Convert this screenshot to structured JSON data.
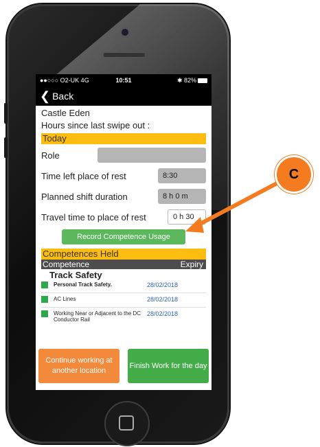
{
  "status_bar": {
    "carrier": "●●○○○ O2-UK  4G",
    "time": "10:51",
    "battery": "✱ 82%"
  },
  "nav": {
    "back_label": "Back"
  },
  "location": {
    "name": "Castle Eden",
    "hours_since_label": "Hours since last swipe out :"
  },
  "today": {
    "header": "Today",
    "role_label": "Role",
    "role_value": "",
    "time_left_label": "Time left place of rest",
    "time_left_value": "8:30",
    "planned_label": "Planned shift duration",
    "planned_value": "8 h  0 m",
    "travel_label": "Travel time to place of rest",
    "travel_value": "0 h 30"
  },
  "record_button": "Record Competence Usage",
  "competences": {
    "header": "Competences Held",
    "col_competence": "Competence",
    "col_expiry": "Expiry",
    "group": "Track Safety",
    "items": [
      {
        "name": "Personal Track Safety.",
        "expiry": "28/02/2018",
        "color": "#2ea84a"
      },
      {
        "name": "AC Lines",
        "expiry": "28/02/2018",
        "color": "#2ea84a"
      },
      {
        "name": "Working Near or Adjacent to the DC Conductor Rail",
        "expiry": "28/02/2018",
        "color": "#2ea84a"
      }
    ]
  },
  "buttons": {
    "continue": "Continue working at another location",
    "finish": "Finish Work for the day"
  },
  "callout": {
    "label": "C",
    "color": "#f47b20"
  }
}
